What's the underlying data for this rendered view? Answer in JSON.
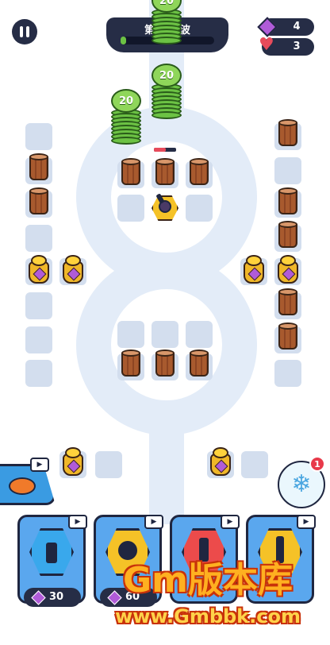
{
  "hud": {
    "wave_label": "第1/15波",
    "gems": "4",
    "lives": "3"
  },
  "stacks": [
    {
      "label": "20"
    },
    {
      "label": "20"
    },
    {
      "label": "20"
    }
  ],
  "freeze": {
    "badge": "1"
  },
  "cards": [
    {
      "cost": "30"
    },
    {
      "cost": "60"
    }
  ],
  "watermark": {
    "title": "Gm版本库",
    "url": "www.Gmbbk.com"
  },
  "colors": {
    "track": "#e3ecf8",
    "slot": "#d3deee",
    "gem": "#b05bd8",
    "heart": "#e84b5b",
    "hud_bg": "#262d46",
    "card_blue": "#39a8ec",
    "card_yellow": "#f5c227",
    "card_red": "#ec4b4b"
  }
}
